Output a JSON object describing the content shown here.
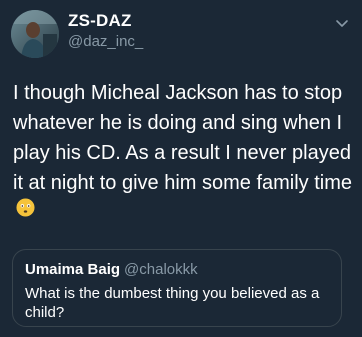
{
  "tweet": {
    "display_name": "ZS-DAZ",
    "handle": "@daz_inc_",
    "text": "I though Micheal Jackson has to stop whatever he is doing and sing when I play his CD. As a result I never played it at night to give him some family time",
    "emoji": "flushed-face-emoji",
    "menu_icon": "chevron-down-icon"
  },
  "quote": {
    "display_name": "Umaima Baig",
    "handle": "@chalokkk",
    "text": "What is the dumbest thing you believed as a child?"
  },
  "colors": {
    "background": "#1b2836",
    "text": "#ffffff",
    "secondary": "#8899a6",
    "border": "#38444d"
  }
}
